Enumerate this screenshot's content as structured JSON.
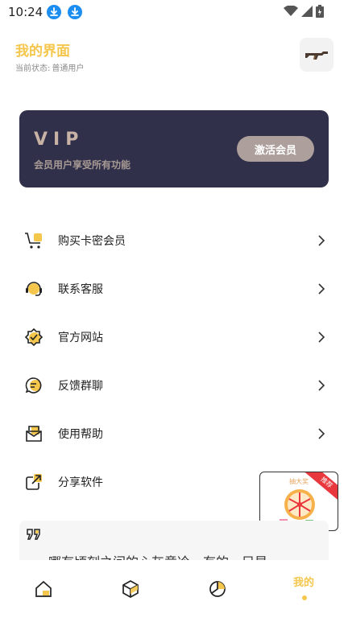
{
  "status_bar": {
    "time": "10:24"
  },
  "header": {
    "title": "我的界面",
    "status_label": "当前状态:",
    "status_value": "普通用户"
  },
  "vip_card": {
    "title": "VIP",
    "subtitle": "会员用户享受所有功能",
    "button_label": "激活会员"
  },
  "menu": [
    {
      "label": "购买卡密会员",
      "icon": "cart-icon"
    },
    {
      "label": "联系客服",
      "icon": "support-icon"
    },
    {
      "label": "官方网站",
      "icon": "website-badge-icon"
    },
    {
      "label": "反馈群聊",
      "icon": "chat-icon"
    },
    {
      "label": "使用帮助",
      "icon": "mail-help-icon"
    },
    {
      "label": "分享软件",
      "icon": "share-icon"
    }
  ],
  "promo": {
    "title": "抽大奖",
    "badge": "推荐"
  },
  "quote": {
    "text": "哪有顷刻之间的心灰意冷，有的，只是"
  },
  "bottom_nav": {
    "active_label": "我的"
  },
  "colors": {
    "accent": "#f4c64c",
    "vip_bg": "#30304a",
    "vip_button": "#ad9f9b"
  }
}
